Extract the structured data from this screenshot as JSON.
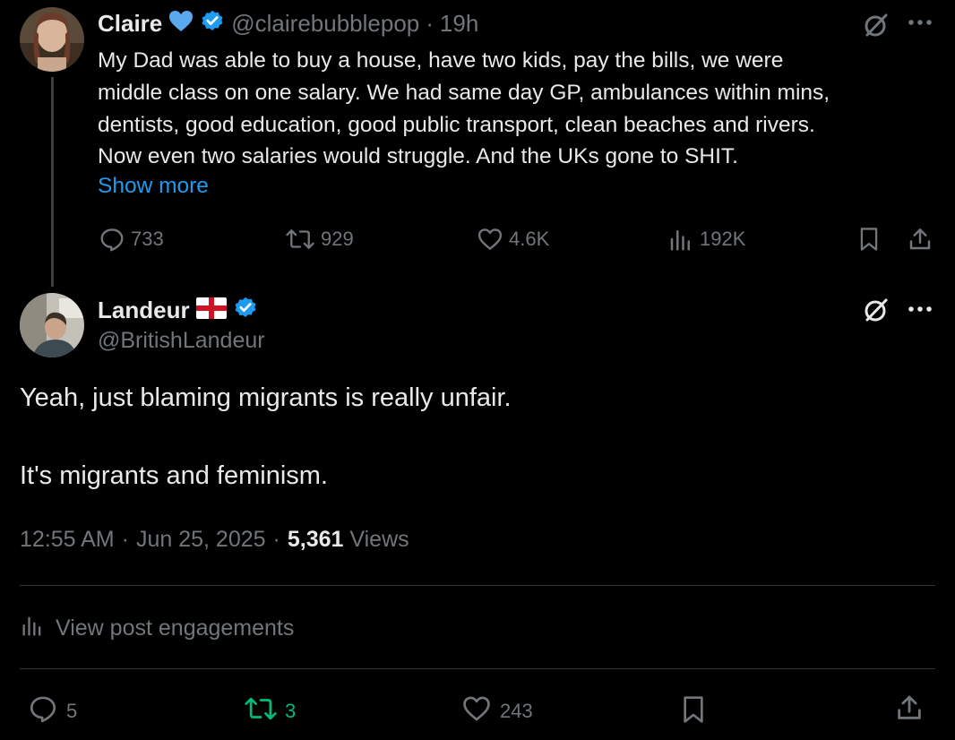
{
  "parent_tweet": {
    "author_name": "Claire",
    "handle": "@clairebubblepop",
    "separator": "·",
    "time": "19h",
    "body_lines": [
      "My Dad was able to buy a house, have two kids, pay the bills, we were",
      "middle class on one salary. We had same day GP, ambulances within mins,",
      "dentists, good education, good public transport, clean beaches and rivers.",
      "Now even two salaries would struggle. And the UKs gone to SHIT."
    ],
    "show_more": "Show more",
    "replies": "733",
    "reposts": "929",
    "likes": "4.6K",
    "views": "192K"
  },
  "main_tweet": {
    "author_name": "Landeur",
    "handle": "@BritishLandeur",
    "text_line_1": "Yeah, just blaming migrants is really unfair.",
    "text_line_2": "It's migrants and feminism.",
    "time": "12:55 AM",
    "separator": "·",
    "date": "Jun 25, 2025",
    "views_count": "5,361",
    "views_label": "Views",
    "engagements_label": "View post engagements",
    "replies": "5",
    "reposts": "3",
    "likes": "243"
  },
  "colors": {
    "background": "#000000",
    "text": "#e7e9ea",
    "muted": "#71767b",
    "link": "#1d9bf0",
    "verified": "#1d9bf0",
    "repost_active": "#00ba7c"
  }
}
